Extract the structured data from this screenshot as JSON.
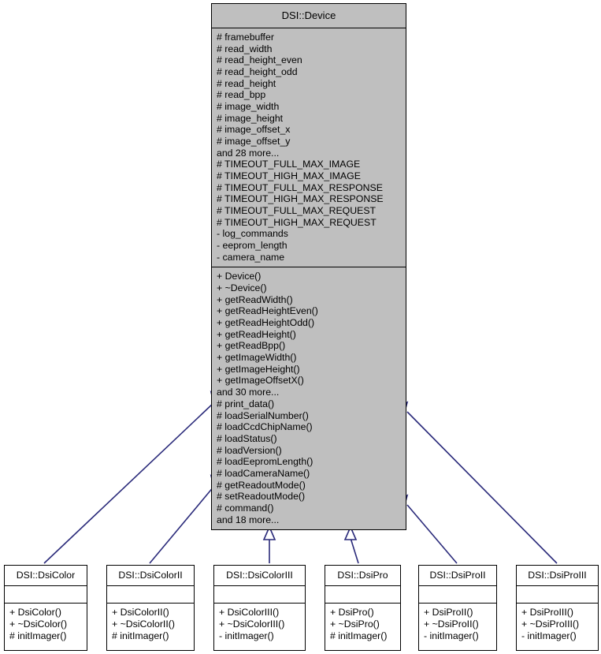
{
  "diagram": {
    "kind": "uml-class-inheritance-diagram",
    "colors": {
      "base_fill": "#bfbfbf",
      "derived_fill": "#ffffff",
      "border": "#000000",
      "connector": "#2a2a7a",
      "background": "#ffffff"
    }
  },
  "base_class": {
    "name": "DSI::Device",
    "attributes": [
      "# framebuffer",
      "# read_width",
      "# read_height_even",
      "# read_height_odd",
      "# read_height",
      "# read_bpp",
      "# image_width",
      "# image_height",
      "# image_offset_x",
      "# image_offset_y",
      "and 28 more...",
      "# TIMEOUT_FULL_MAX_IMAGE",
      "# TIMEOUT_HIGH_MAX_IMAGE",
      "# TIMEOUT_FULL_MAX_RESPONSE",
      "# TIMEOUT_HIGH_MAX_RESPONSE",
      "# TIMEOUT_FULL_MAX_REQUEST",
      "# TIMEOUT_HIGH_MAX_REQUEST",
      "- log_commands",
      "- eeprom_length",
      "- camera_name"
    ],
    "operations": [
      "+ Device()",
      "+ ~Device()",
      "+ getReadWidth()",
      "+ getReadHeightEven()",
      "+ getReadHeightOdd()",
      "+ getReadHeight()",
      "+ getReadBpp()",
      "+ getImageWidth()",
      "+ getImageHeight()",
      "+ getImageOffsetX()",
      "and 30 more...",
      "# print_data()",
      "# loadSerialNumber()",
      "# loadCcdChipName()",
      "# loadStatus()",
      "# loadVersion()",
      "# loadEepromLength()",
      "# loadCameraName()",
      "# getReadoutMode()",
      "# setReadoutMode()",
      "# command()",
      "and 18 more..."
    ]
  },
  "derived_classes": [
    {
      "name": "DSI::DsiColor",
      "attributes": [],
      "operations": [
        "+ DsiColor()",
        "+ ~DsiColor()",
        "# initImager()"
      ]
    },
    {
      "name": "DSI::DsiColorII",
      "attributes": [],
      "operations": [
        "+ DsiColorII()",
        "+ ~DsiColorII()",
        "# initImager()"
      ]
    },
    {
      "name": "DSI::DsiColorIII",
      "attributes": [],
      "operations": [
        "+ DsiColorIII()",
        "+ ~DsiColorIII()",
        "- initImager()"
      ]
    },
    {
      "name": "DSI::DsiPro",
      "attributes": [],
      "operations": [
        "+ DsiPro()",
        "+ ~DsiPro()",
        "# initImager()"
      ]
    },
    {
      "name": "DSI::DsiProII",
      "attributes": [],
      "operations": [
        "+ DsiProII()",
        "+ ~DsiProII()",
        "- initImager()"
      ]
    },
    {
      "name": "DSI::DsiProIII",
      "attributes": [],
      "operations": [
        "+ DsiProIII()",
        "+ ~DsiProIII()",
        "- initImager()"
      ]
    }
  ]
}
